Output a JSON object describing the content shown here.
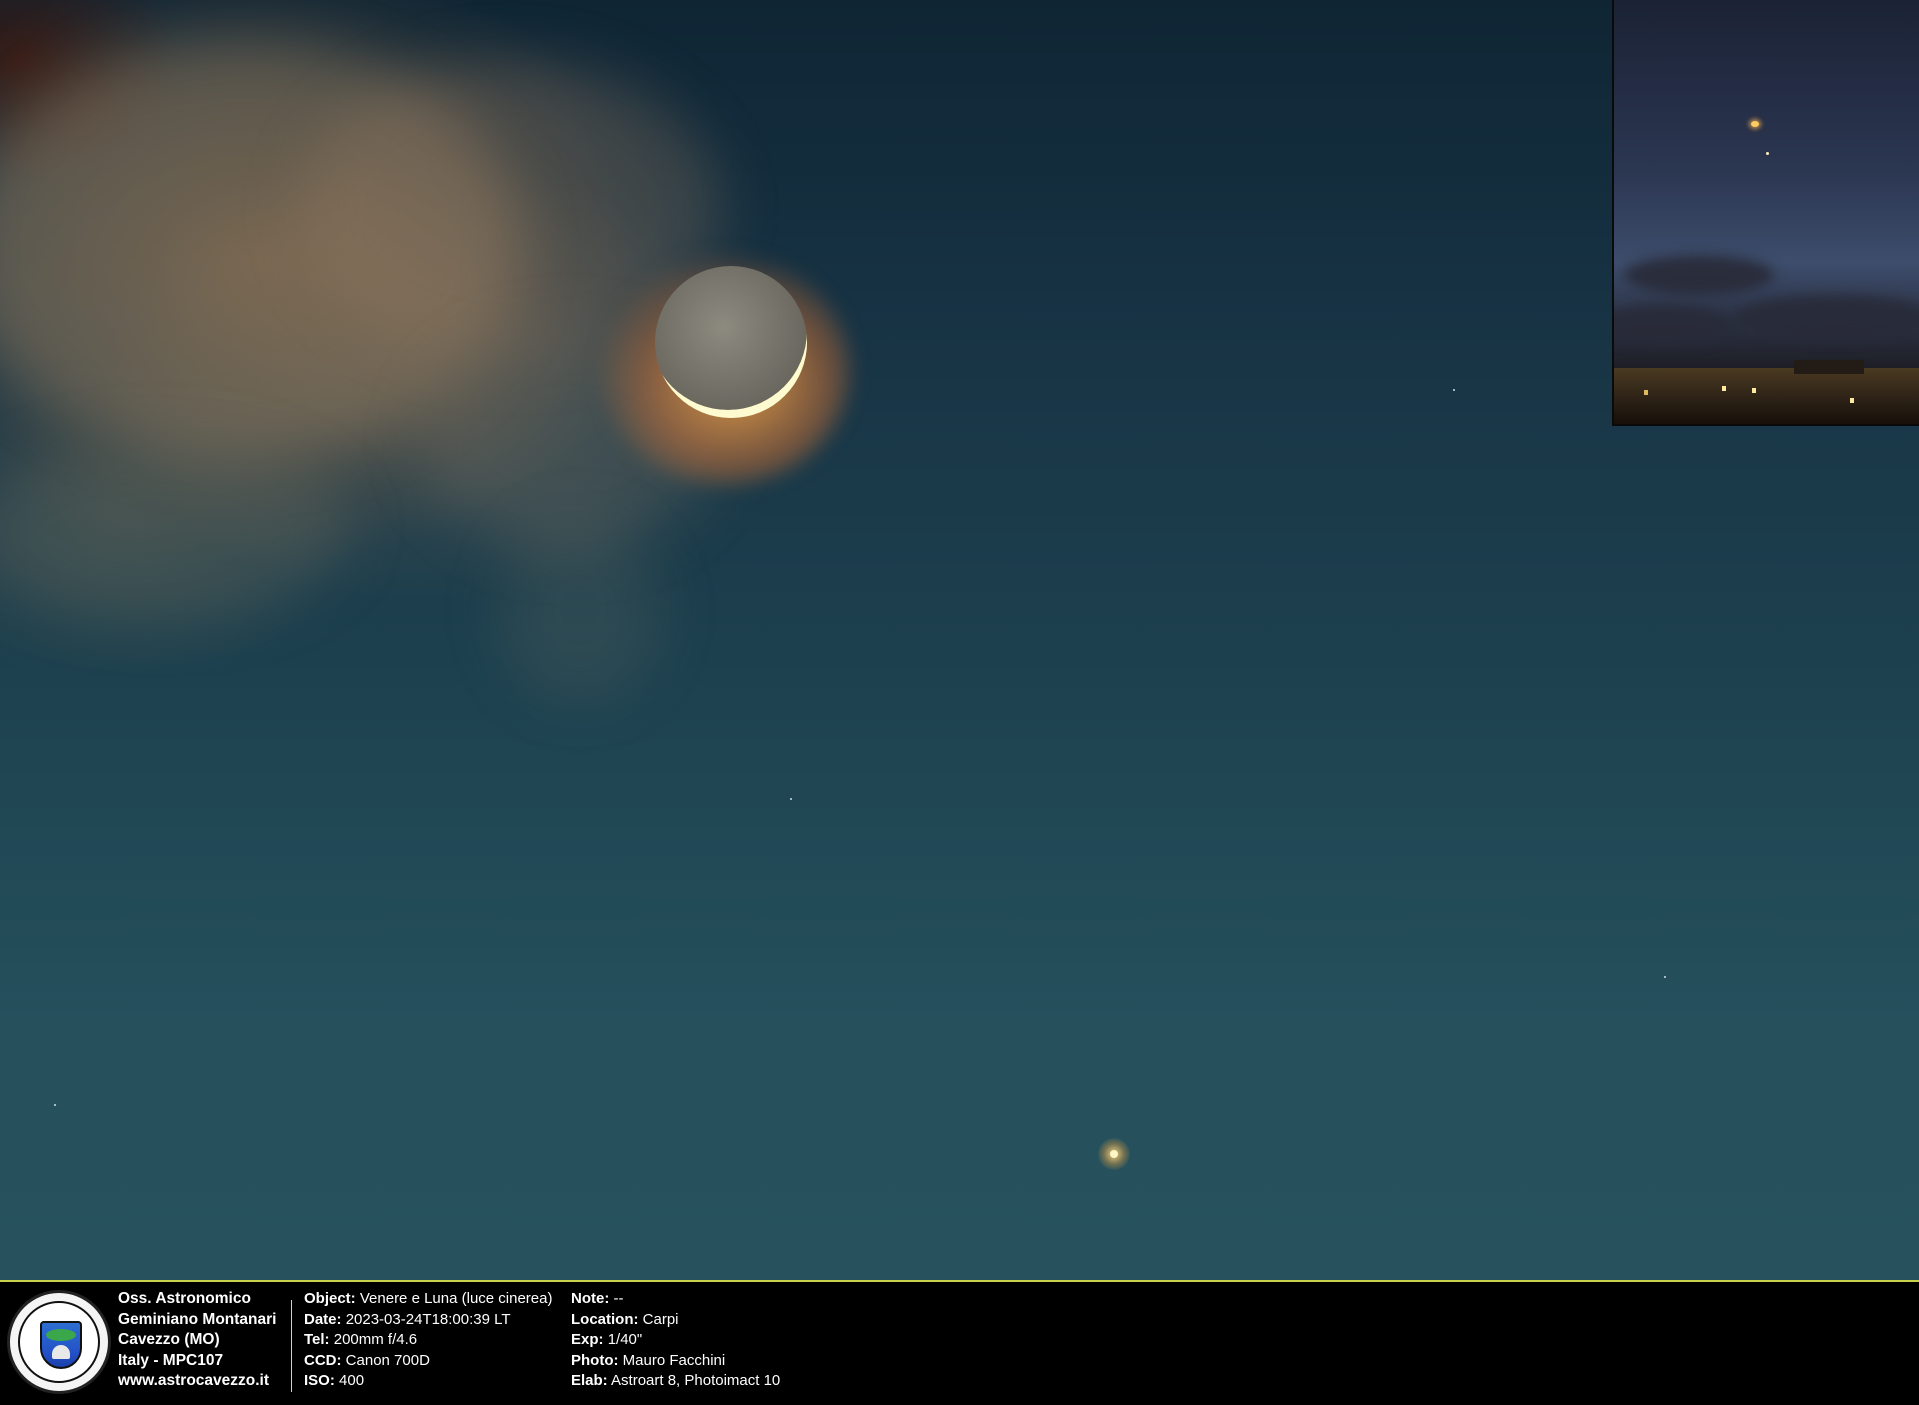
{
  "scene": {
    "subjects": [
      "moon-crescent",
      "venus"
    ]
  },
  "footer": {
    "observatory": {
      "line1": "Oss. Astronomico",
      "line2": "Geminiano Montanari",
      "line3": "Cavezzo (MO)",
      "line4": "Italy - MPC107",
      "line5": "www.astrocavezzo.it"
    },
    "info1": [
      {
        "label": "Object:",
        "value": "Venere e Luna (luce cinerea)"
      },
      {
        "label": "Date:",
        "value": "2023-03-24T18:00:39 LT"
      },
      {
        "label": "Tel:",
        "value": "200mm f/4.6"
      },
      {
        "label": "CCD:",
        "value": "Canon 700D"
      },
      {
        "label": "ISO:",
        "value": "400"
      }
    ],
    "info2": [
      {
        "label": "Note:",
        "value": "--"
      },
      {
        "label": "Location:",
        "value": "Carpi"
      },
      {
        "label": "Exp:",
        "value": "1/40\""
      },
      {
        "label": "Photo:",
        "value": "Mauro Facchini"
      },
      {
        "label": "Elab:",
        "value": "Astroart 8, Photoimact 10"
      }
    ]
  }
}
